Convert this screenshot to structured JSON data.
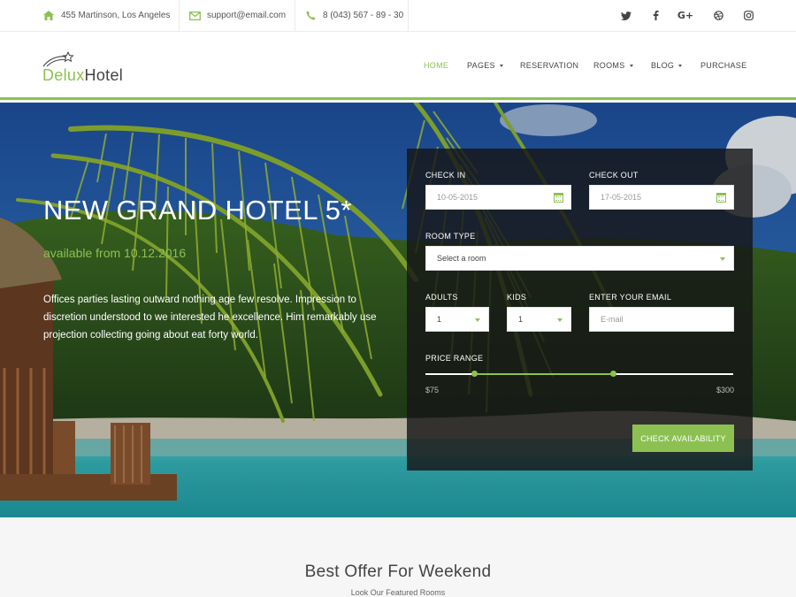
{
  "topbar": {
    "address": "455 Martinson, Los Angeles",
    "email": "support@email.com",
    "phone": "8 (043) 567 - 89 - 30",
    "social": [
      "twitter",
      "facebook",
      "google-plus",
      "dribbble",
      "instagram"
    ]
  },
  "logo": {
    "part1": "Delux",
    "part2": "Hotel"
  },
  "nav": [
    {
      "label": "HOME",
      "active": true,
      "dropdown": false
    },
    {
      "label": "PAGES",
      "active": false,
      "dropdown": true
    },
    {
      "label": "RESERVATION",
      "active": false,
      "dropdown": false
    },
    {
      "label": "ROOMS",
      "active": false,
      "dropdown": true
    },
    {
      "label": "BLOG",
      "active": false,
      "dropdown": true
    },
    {
      "label": "PURCHASE",
      "active": false,
      "dropdown": false
    }
  ],
  "hero": {
    "title": "NEW GRAND HOTEL 5*",
    "subtitle": "available from 10.12.2016",
    "text": "Offices parties lasting outward nothing age few resolve. Impression to discretion understood to we interested he excellence. Him remarkably use projection collecting going about eat forty world."
  },
  "booking": {
    "check_in_label": "CHECK IN",
    "check_in_value": "10-05-2015",
    "check_out_label": "CHECK OUT",
    "check_out_value": "17-05-2015",
    "room_type_label": "ROOM TYPE",
    "room_type_value": "Select a room",
    "adults_label": "ADULTS",
    "adults_value": "1",
    "kids_label": "KIDS",
    "kids_value": "1",
    "email_label": "ENTER YOUR EMAIL",
    "email_placeholder": "E-mail",
    "price_label": "PRICE RANGE",
    "price_min": "$75",
    "price_max": "$300",
    "range_low_fraction": 0.16,
    "range_high_fraction": 0.61,
    "button": "CHECK AVAILABILITY"
  },
  "section": {
    "title": "Best Offer For Weekend",
    "subtitle": "Look Our Featured Rooms"
  },
  "colors": {
    "accent": "#8cc152",
    "text": "#444444"
  }
}
